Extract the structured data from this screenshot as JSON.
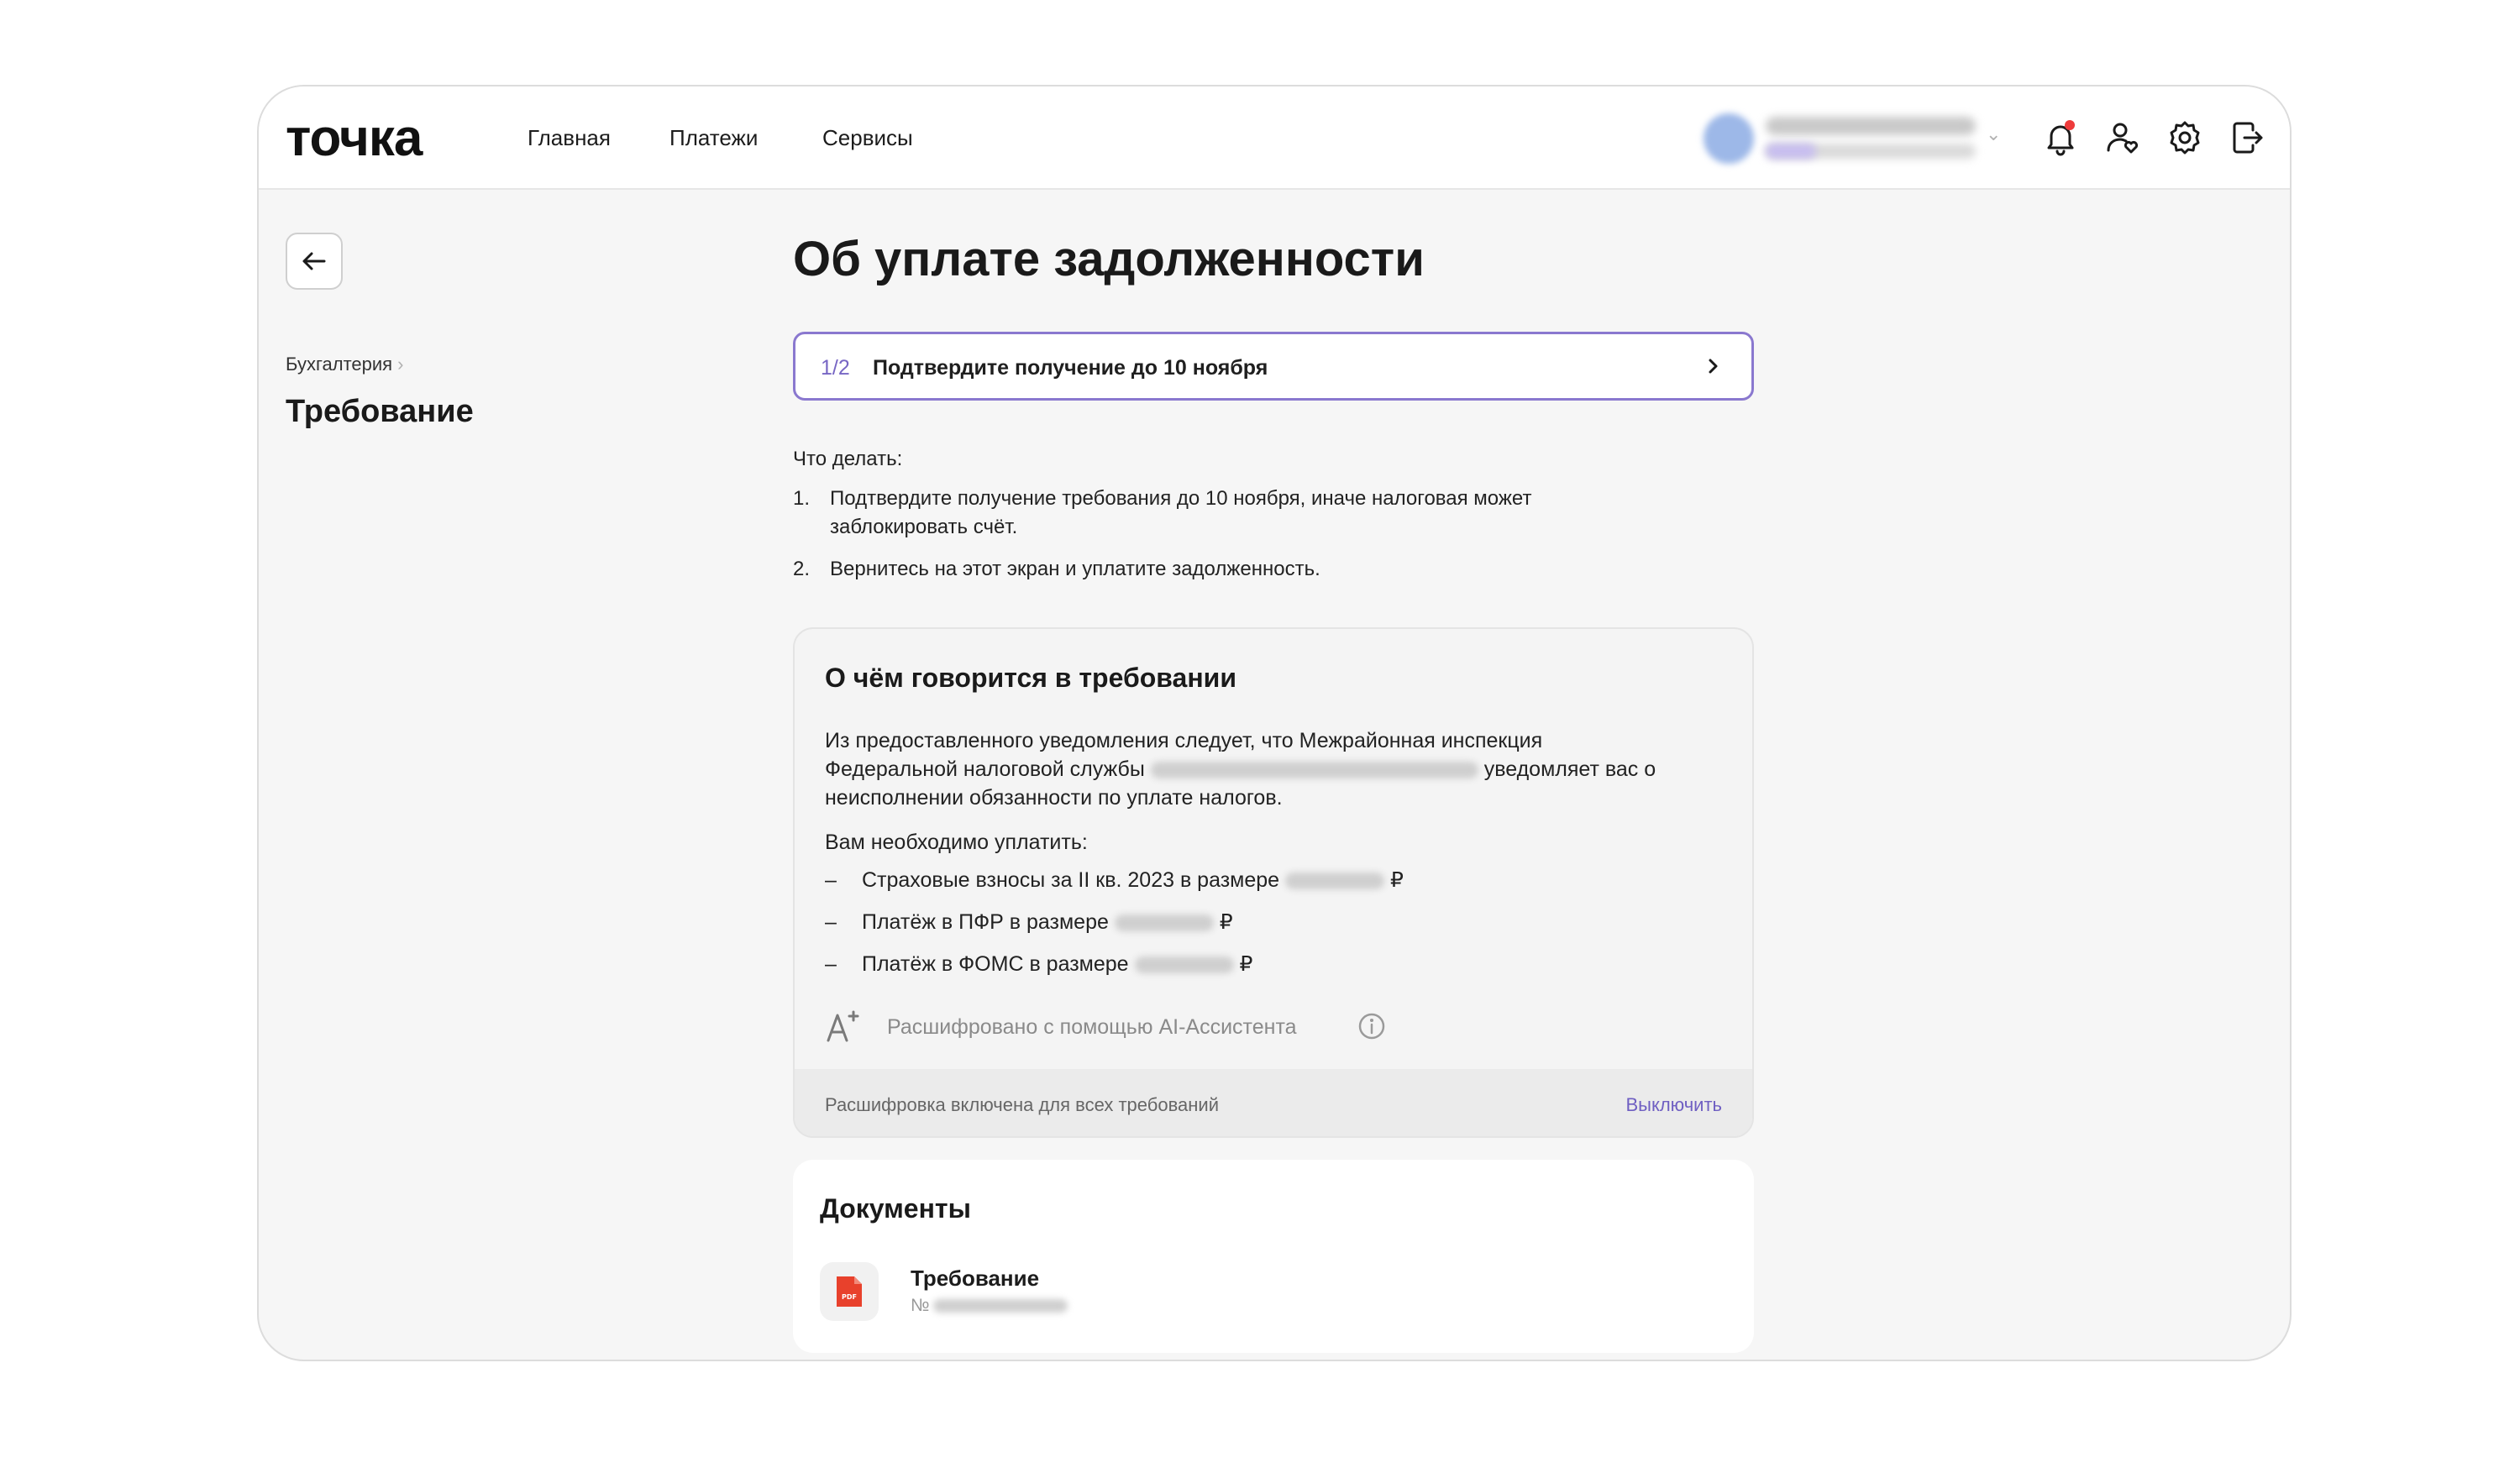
{
  "header": {
    "logo": "точка",
    "nav": [
      "Главная",
      "Платежи",
      "Сервисы"
    ],
    "icons": [
      "bell-icon",
      "user-heart-icon",
      "gear-icon",
      "logout-icon"
    ]
  },
  "sidebar": {
    "breadcrumb": "Бухгалтерия",
    "title": "Требование"
  },
  "main": {
    "title": "Об уплате задолженности",
    "step": {
      "count": "1/2",
      "label": "Подтвердите получение до 10 ноября"
    },
    "todo": {
      "title": "Что делать:",
      "items": [
        {
          "num": "1.",
          "text": "Подтвердите получение требования до 10 ноября, иначе налоговая может заблокировать счёт."
        },
        {
          "num": "2.",
          "text": "Вернитесь на этот экран и уплатите задолженность."
        }
      ]
    },
    "ai_card": {
      "title": "О чём говорится в требовании",
      "para_start": "Из предоставленного уведомления следует, что Межрайонная инспекция Федеральной налоговой службы",
      "para_end": "уведомляет вас о неисполнении обязанности по уплате налогов.",
      "need_label": "Вам необходимо уплатить:",
      "payments": [
        {
          "dash": "–",
          "text": "Страховые взносы за II кв. 2023 в размере",
          "currency": "₽"
        },
        {
          "dash": "–",
          "text": "Платёж в ПФР в размере",
          "currency": "₽"
        },
        {
          "dash": "–",
          "text": "Платёж в ФОМС в размере",
          "currency": "₽"
        }
      ],
      "ai_note": "Расшифровано с помощью AI-Ассистента",
      "footer_note": "Расшифровка включена для всех требований",
      "footer_action": "Выключить"
    },
    "documents": {
      "title": "Документы",
      "items": [
        {
          "name": "Требование",
          "number_prefix": "№",
          "file_type": "PDF"
        }
      ]
    }
  },
  "colors": {
    "accent": "#7766c4",
    "notification": "#ee3b3b",
    "pdf": "#e8412c"
  }
}
